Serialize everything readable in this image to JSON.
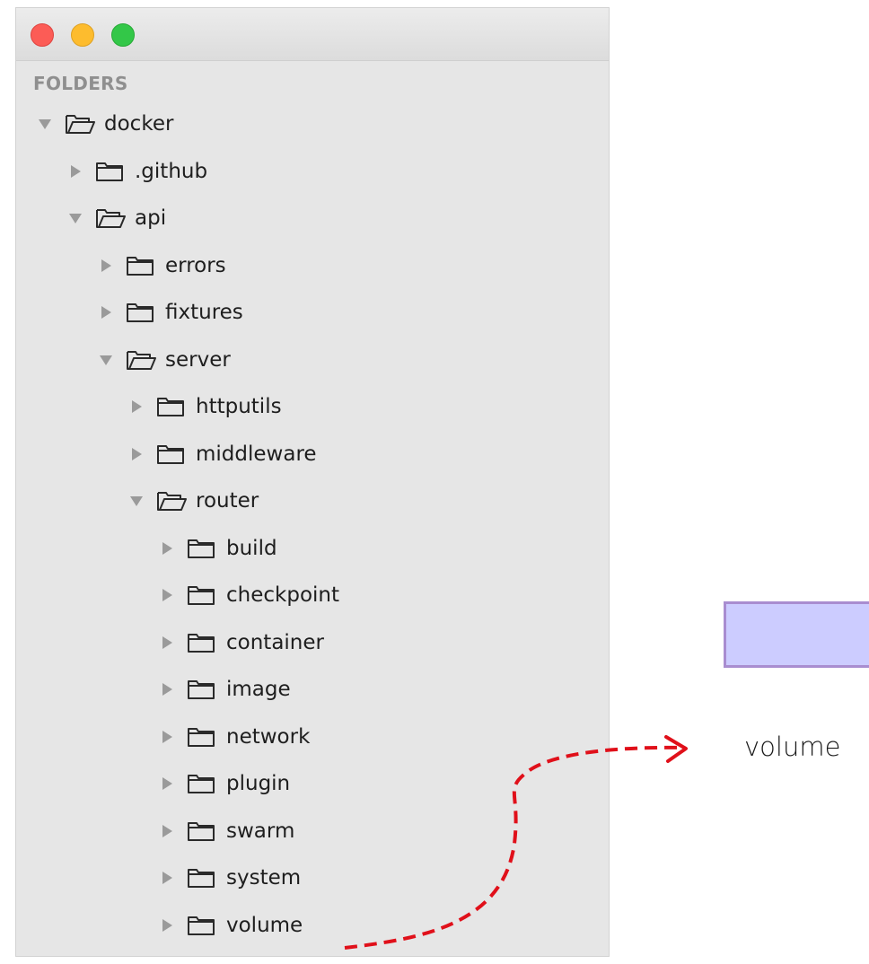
{
  "sidebar": {
    "section_label": "FOLDERS",
    "items": [
      {
        "label": "docker",
        "depth": 0,
        "expanded": true
      },
      {
        "label": ".github",
        "depth": 1,
        "expanded": false
      },
      {
        "label": "api",
        "depth": 1,
        "expanded": true
      },
      {
        "label": "errors",
        "depth": 2,
        "expanded": false
      },
      {
        "label": "fixtures",
        "depth": 2,
        "expanded": false
      },
      {
        "label": "server",
        "depth": 2,
        "expanded": true
      },
      {
        "label": "httputils",
        "depth": 3,
        "expanded": false
      },
      {
        "label": "middleware",
        "depth": 3,
        "expanded": false
      },
      {
        "label": "router",
        "depth": 3,
        "expanded": true
      },
      {
        "label": "build",
        "depth": 4,
        "expanded": false
      },
      {
        "label": "checkpoint",
        "depth": 4,
        "expanded": false
      },
      {
        "label": "container",
        "depth": 4,
        "expanded": false
      },
      {
        "label": "image",
        "depth": 4,
        "expanded": false
      },
      {
        "label": "network",
        "depth": 4,
        "expanded": false
      },
      {
        "label": "plugin",
        "depth": 4,
        "expanded": false
      },
      {
        "label": "swarm",
        "depth": 4,
        "expanded": false
      },
      {
        "label": "system",
        "depth": 4,
        "expanded": false
      },
      {
        "label": "volume",
        "depth": 4,
        "expanded": false
      }
    ]
  },
  "callout": {
    "label": "volume",
    "fill_color": "#ccccff",
    "border_color": "#a98dd0",
    "arrow_color": "#e0101a"
  },
  "window_controls": [
    "close-button",
    "minimize-button",
    "zoom-button"
  ]
}
